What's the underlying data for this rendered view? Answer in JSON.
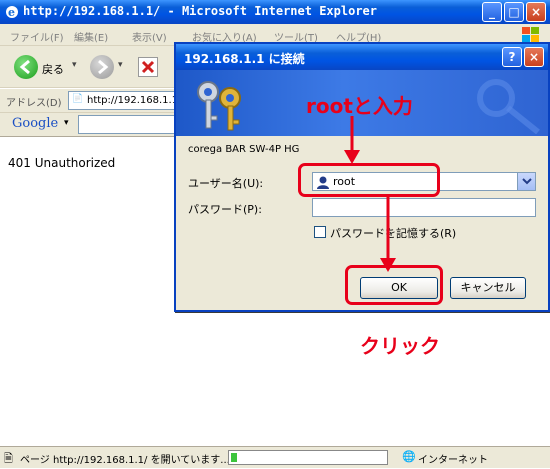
{
  "browser": {
    "title": "http://192.168.1.1/ - Microsoft Internet Explorer",
    "menu": [
      "ファイル(F)",
      "編集(E)",
      "表示(V)",
      "お気に入り(A)",
      "ツール(T)",
      "ヘルプ(H)"
    ],
    "back_label": "戻る",
    "address_label": "アドレス(D)",
    "address_value": "http://192.168.1.1",
    "google_label": "Google",
    "page_text": "401 Unauthorized",
    "status_text": "ページ http://192.168.1.1/ を開いています...",
    "zone_text": "インターネット"
  },
  "dialog": {
    "title": "192.168.1.1 に接続",
    "realm": "corega BAR SW-4P HG",
    "username_label": "ユーザー名(U):",
    "username_value": "root",
    "password_label": "パスワード(P):",
    "password_value": "",
    "remember_label": "パスワードを記憶する(R)",
    "ok_label": "OK",
    "cancel_label": "キャンセル",
    "help_label": "?",
    "close_label": "×"
  },
  "annotations": {
    "enter_root": "rootと入力",
    "click": "クリック",
    "color": "#e8001a"
  }
}
